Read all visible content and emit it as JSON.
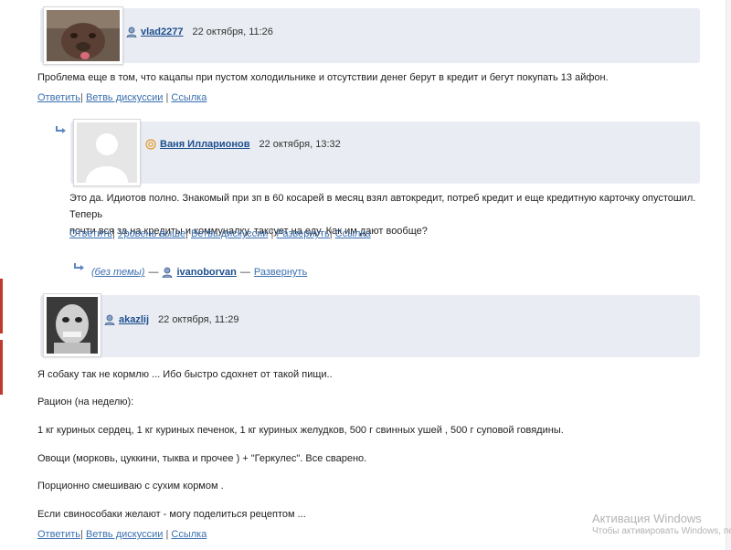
{
  "comments": [
    {
      "username": "vlad2277",
      "date": "22 октября, 11:26",
      "text": "Проблема еще в том, что кацапы при пустом холодильнике и отсутствии денег берут в кредит и бегут покупать 13 айфон.",
      "links": [
        "Ответить",
        "Ветвь дискуссии",
        "Ссылка"
      ]
    },
    {
      "username": "Ваня Илларионов",
      "date": "22 октября, 13:32",
      "text_line1": "Это да. Идиотов полно. Знакомый при зп в 60 косарей в месяц взял автокредит, потреб кредит и еще кредитную карточку опустошил. Теперь",
      "text_line2": "почти вся за на кредиты и коммуналку. таксует на еду. Как им дают вообще?",
      "links": [
        "Ответить",
        "Уровень выше",
        "Ветвь дискуссии",
        "Развернуть",
        "Ссылка"
      ]
    },
    {
      "subject": "(без темы)",
      "username": "ivanoborvan",
      "expand": "Развернуть"
    },
    {
      "username": "akazlij",
      "date": "22 октября, 11:29",
      "paragraphs": [
        "Я собаку так не кормлю ... Ибо быстро сдохнет от такой пищи..",
        "Рацион (на неделю):",
        "1 кг куриных сердец, 1 кг куриных печенок, 1 кг куриных желудков, 500 г свинных ушей , 500 г суповой говядины.",
        "Овощи (морковь, цуккини, тыква и прочее ) + \"Геркулес\". Все сварено.",
        "Порционно смешиваю с сухим кормом .",
        "Если свинособаки желают - могу поделиться рецептом ..."
      ],
      "links": [
        "Ответить",
        "Ветвь дискуссии",
        "Ссылка"
      ]
    }
  ],
  "watermark": {
    "title": "Активация Windows",
    "subtitle": "Чтобы активировать Windows, пе"
  },
  "colors": {
    "header_bg": "#e9ecf2",
    "link": "#3a6fb0",
    "username": "#1e4f8f"
  },
  "icons": [
    "user-icon",
    "reply-arrow-icon",
    "vk-icon"
  ]
}
